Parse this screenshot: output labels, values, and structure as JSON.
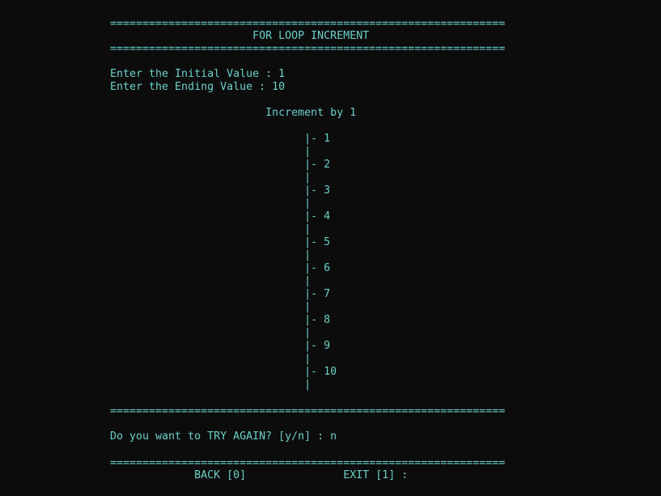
{
  "separator": "=============================================================",
  "title": "                      FOR LOOP INCREMENT",
  "prompts": {
    "initial": "Enter the Initial Value : 1",
    "ending": "Enter the Ending Value : 10"
  },
  "increment_label": "                        Increment by 1",
  "loop_items": [
    "                              |- 1",
    "                              |",
    "                              |- 2",
    "                              |",
    "                              |- 3",
    "                              |",
    "                              |- 4",
    "                              |",
    "                              |- 5",
    "                              |",
    "                              |- 6",
    "                              |",
    "                              |- 7",
    "                              |",
    "                              |- 8",
    "                              |",
    "                              |- 9",
    "                              |",
    "                              |- 10",
    "                              |"
  ],
  "try_again_prompt": "Do you want to TRY AGAIN? [y/n] : n",
  "menu": "             BACK [0]               EXIT [1] :"
}
